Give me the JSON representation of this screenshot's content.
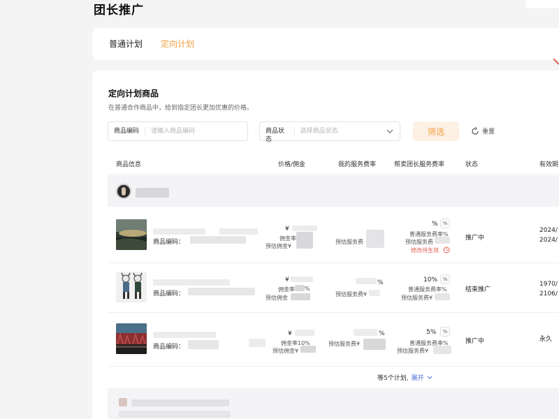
{
  "page": {
    "title": "团长推广"
  },
  "tabs": [
    {
      "label": "普通计划",
      "active": false
    },
    {
      "label": "定向计划",
      "active": true
    }
  ],
  "section": {
    "title": "定向计划商品",
    "desc": "在普通合作商品中，给到指定团长更加优惠的价格。"
  },
  "filters": {
    "code_label": "商品编码",
    "code_placeholder": "请输入商品编码",
    "status_label": "商品状态",
    "status_placeholder": "选择商品状态",
    "filter_btn": "筛选",
    "reset": "重置"
  },
  "table": {
    "headers": [
      "商品信息",
      "价格/佣金",
      "我的服务费率",
      "帮卖团长服务费率",
      "状态",
      "有效期"
    ],
    "rows": [
      {
        "code_label": "商品编码：",
        "price": "¥",
        "commission_rate": "佣金率",
        "est_commission": "预估佣金¥",
        "est_service_fee": "预估服务费",
        "rate_value": "%",
        "pct_mark": "%",
        "normal_rate": "普通服务费率%",
        "est_service_fee2": "预估服务费",
        "edit_notice": "修改待生效",
        "status": "推广中",
        "date1": "2024/",
        "date2": "2024/"
      },
      {
        "code_label": "商品编码：",
        "price": "¥",
        "commission_rate": "佣金率",
        "est_commission": "预估佣金",
        "est_service_fee": "预估服务费¥",
        "my_rate": "%",
        "rate_value": "10%",
        "pct_mark": "%",
        "normal_rate": "普通服务费率%",
        "est_service_fee2": "预估服务费¥",
        "status": "结束推广",
        "date1": "1970/",
        "date2": "2106/"
      },
      {
        "code_label": "商品编码：",
        "price": "¥",
        "commission_rate": "佣金率10%",
        "est_commission": "预估佣金¥",
        "est_service_fee": "预估服务费¥",
        "my_rate": "%",
        "rate_value": "5%",
        "pct_mark": "%",
        "normal_rate": "普通服务费率%",
        "est_service_fee2": "预估服务费¥",
        "status": "推广中",
        "date1": "永久"
      }
    ]
  },
  "footer": {
    "summary": "等5个计划,",
    "expand": "展开"
  },
  "colors": {
    "accent": "#f0a040",
    "link": "#4a6fd8",
    "warn": "#e05a4a"
  }
}
